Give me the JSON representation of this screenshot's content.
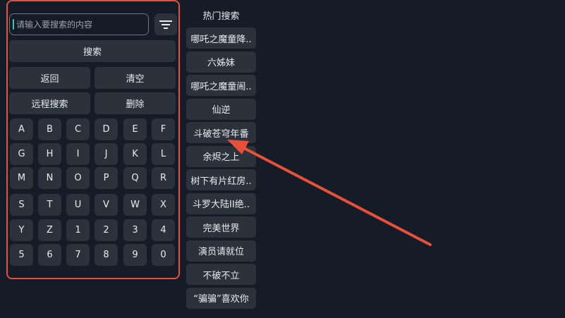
{
  "search": {
    "placeholder": "请输入要搜索的内容",
    "search_label": "搜索",
    "back_label": "返回",
    "clear_label": "清空",
    "remote_label": "远程搜索",
    "delete_label": "删除"
  },
  "keyboard": {
    "keys": [
      "A",
      "B",
      "C",
      "D",
      "E",
      "F",
      "G",
      "H",
      "I",
      "J",
      "K",
      "L",
      "M",
      "N",
      "O",
      "P",
      "Q",
      "R",
      "S",
      "T",
      "U",
      "V",
      "W",
      "X",
      "Y",
      "Z",
      "1",
      "2",
      "3",
      "4",
      "5",
      "6",
      "7",
      "8",
      "9",
      "0"
    ]
  },
  "hot": {
    "title": "热门搜索",
    "items": [
      "哪吒之魔童降..",
      "六姊妹",
      "哪吒之魔童闹..",
      "仙逆",
      "斗破苍穹年番",
      "余烬之上",
      "树下有片红房..",
      "斗罗大陆II绝..",
      "完美世界",
      "演员请就位",
      "不破不立",
      "“骗骗”喜欢你"
    ]
  },
  "colors": {
    "background": "#151c27",
    "button": "#2b323c",
    "annotation": "#e8503a",
    "caret": "#39c8b4"
  }
}
